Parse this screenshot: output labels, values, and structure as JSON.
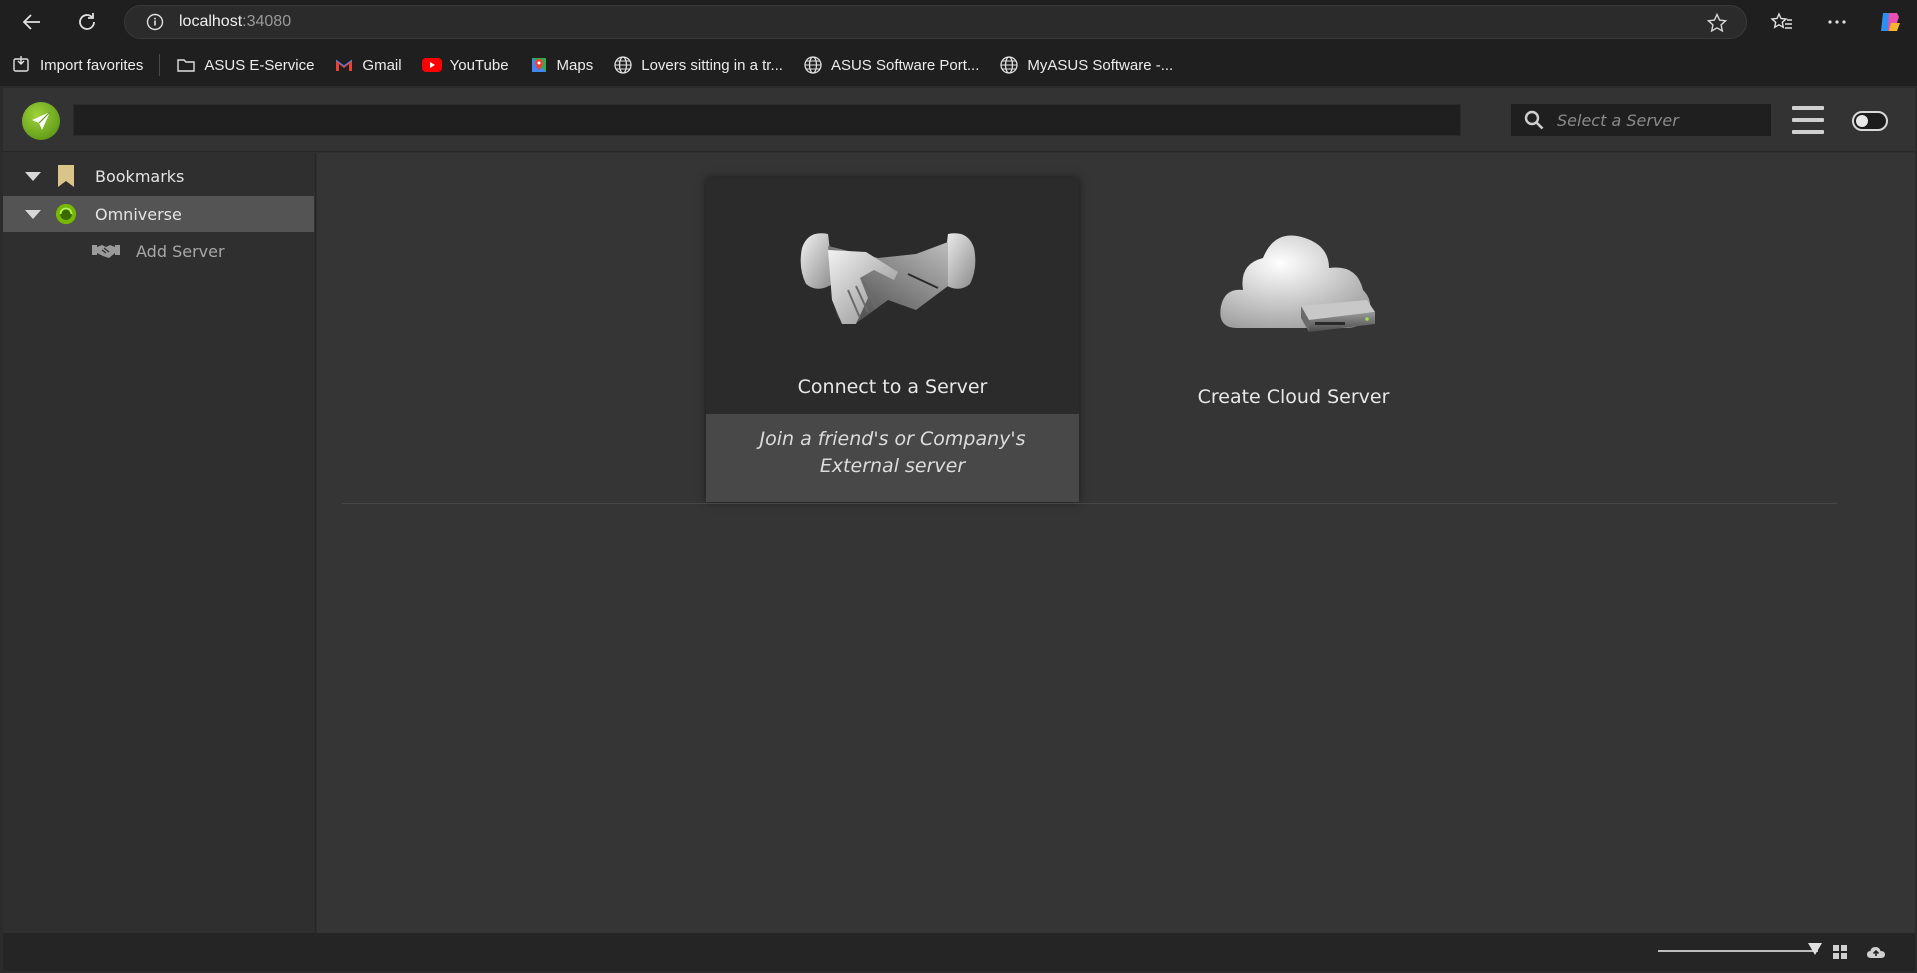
{
  "browser": {
    "url_host": "localhost",
    "url_port": ":34080",
    "bookmarks": [
      {
        "label": "Import favorites",
        "icon": "import-icon"
      },
      {
        "label": "ASUS E-Service",
        "icon": "folder-icon"
      },
      {
        "label": "Gmail",
        "icon": "gmail-icon"
      },
      {
        "label": "YouTube",
        "icon": "youtube-icon"
      },
      {
        "label": "Maps",
        "icon": "maps-icon"
      },
      {
        "label": "Lovers sitting in a tr...",
        "icon": "globe-icon"
      },
      {
        "label": "ASUS Software Port...",
        "icon": "globe-icon"
      },
      {
        "label": "MyASUS Software -...",
        "icon": "globe-icon"
      }
    ]
  },
  "app": {
    "path_value": "",
    "search_placeholder": "Select a Server",
    "sidebar": {
      "items": [
        {
          "label": "Bookmarks",
          "icon": "bookmark-icon"
        },
        {
          "label": "Omniverse",
          "icon": "omniverse-icon"
        }
      ],
      "subitems": [
        {
          "label": "Add Server",
          "icon": "handshake-icon"
        }
      ]
    },
    "cards": [
      {
        "title": "Connect to a Server",
        "description": "Join a friend's or Company's External server",
        "icon": "handshake-icon"
      },
      {
        "title": "Create Cloud Server",
        "icon": "cloud-server-icon"
      }
    ]
  },
  "colors": {
    "accent": "#76b900",
    "background": "#353535"
  }
}
